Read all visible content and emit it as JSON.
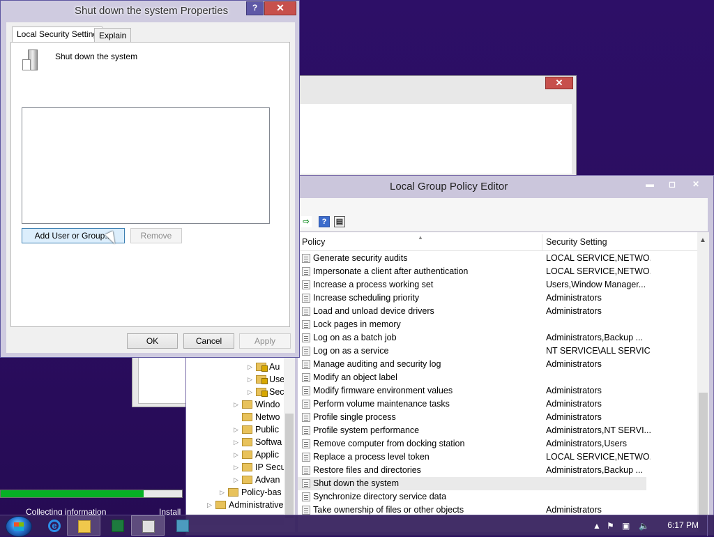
{
  "desktop": {
    "progress_fraction": 0.79,
    "status_left": "Collecting information",
    "status_right": "Install"
  },
  "gpe": {
    "title": "Local Group Policy Editor",
    "min_glyph": "▬",
    "max_glyph": "◻",
    "close_glyph": "✕",
    "tree": [
      {
        "label": "Au",
        "expand": "▷",
        "lock": true
      },
      {
        "label": "Use",
        "expand": "▷",
        "lock": true
      },
      {
        "label": "Sec",
        "expand": "▷",
        "lock": true
      },
      {
        "label": "Windo",
        "expand": "▷",
        "lock": false
      },
      {
        "label": "Netwo",
        "expand": "",
        "lock": false
      },
      {
        "label": "Public",
        "expand": "▷",
        "lock": false
      },
      {
        "label": "Softwa",
        "expand": "▷",
        "lock": false
      },
      {
        "label": "Applic",
        "expand": "▷",
        "lock": false
      },
      {
        "label": "IP Secu",
        "expand": "▷",
        "lock": false
      },
      {
        "label": "Advan",
        "expand": "▷",
        "lock": false
      },
      {
        "label": "Policy-bas",
        "expand": "▷",
        "lock": false
      },
      {
        "label": "Administrative",
        "expand": "▷",
        "lock": false
      }
    ],
    "columns": {
      "policy": "Policy",
      "setting": "Security Setting"
    },
    "rows": [
      {
        "name": "Generate security audits",
        "setting": "LOCAL SERVICE,NETWO..."
      },
      {
        "name": "Impersonate a client after authentication",
        "setting": "LOCAL SERVICE,NETWO..."
      },
      {
        "name": "Increase a process working set",
        "setting": "Users,Window Manager..."
      },
      {
        "name": "Increase scheduling priority",
        "setting": "Administrators"
      },
      {
        "name": "Load and unload device drivers",
        "setting": "Administrators"
      },
      {
        "name": "Lock pages in memory",
        "setting": ""
      },
      {
        "name": "Log on as a batch job",
        "setting": "Administrators,Backup ..."
      },
      {
        "name": "Log on as a service",
        "setting": "NT SERVICE\\ALL SERVIC..."
      },
      {
        "name": "Manage auditing and security log",
        "setting": "Administrators"
      },
      {
        "name": "Modify an object label",
        "setting": ""
      },
      {
        "name": "Modify firmware environment values",
        "setting": "Administrators"
      },
      {
        "name": "Perform volume maintenance tasks",
        "setting": "Administrators"
      },
      {
        "name": "Profile single process",
        "setting": "Administrators"
      },
      {
        "name": "Profile system performance",
        "setting": "Administrators,NT SERVI..."
      },
      {
        "name": "Remove computer from docking station",
        "setting": "Administrators,Users"
      },
      {
        "name": "Replace a process level token",
        "setting": "LOCAL SERVICE,NETWO..."
      },
      {
        "name": "Restore files and directories",
        "setting": "Administrators,Backup ..."
      },
      {
        "name": "Shut down the system",
        "setting": "",
        "selected": true
      },
      {
        "name": "Synchronize directory service data",
        "setting": ""
      },
      {
        "name": "Take ownership of files or other objects",
        "setting": "Administrators"
      }
    ]
  },
  "dialog": {
    "title": "Shut down the system Properties",
    "help_glyph": "?",
    "close_glyph": "✕",
    "tabs": [
      "Local Security Setting",
      "Explain"
    ],
    "policy_name": "Shut down the system",
    "add_button": "Add User or Group...",
    "remove_button": "Remove",
    "ok_button": "OK",
    "cancel_button": "Cancel",
    "apply_button": "Apply"
  },
  "taskbar": {
    "clock": "6:17 PM",
    "tray_up": "▲",
    "tray_flag": "⚑",
    "tray_net": "▣",
    "tray_vol": "🔈",
    "ie_glyph": "e"
  },
  "colors": {
    "desktop": "#2b1160",
    "progress": "#06b025",
    "close_red": "#c7504c"
  }
}
